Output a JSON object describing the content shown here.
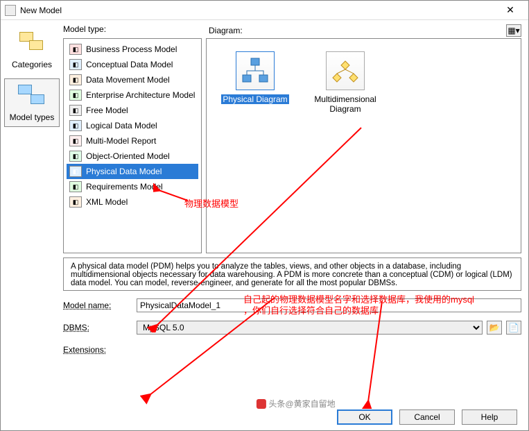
{
  "window": {
    "title": "New Model",
    "close_glyph": "✕"
  },
  "left": {
    "categories_label": "Categories",
    "modeltypes_label": "Model types"
  },
  "headers": {
    "model_type": "Model type:",
    "diagram": "Diagram:"
  },
  "model_types": [
    {
      "label": "Business Process Model"
    },
    {
      "label": "Conceptual Data Model"
    },
    {
      "label": "Data Movement Model"
    },
    {
      "label": "Enterprise Architecture Model"
    },
    {
      "label": "Free Model"
    },
    {
      "label": "Logical Data Model"
    },
    {
      "label": "Multi-Model Report"
    },
    {
      "label": "Object-Oriented Model"
    },
    {
      "label": "Physical Data Model"
    },
    {
      "label": "Requirements Model"
    },
    {
      "label": "XML Model"
    }
  ],
  "diagrams": [
    {
      "label": "Physical Diagram"
    },
    {
      "label": "Multidimensional Diagram"
    }
  ],
  "description": "A physical data model (PDM) helps you to analyze the tables, views, and other objects in a database, including multidimensional objects necessary for data warehousing. A PDM is more concrete than a conceptual (CDM) or logical (LDM) data model. You can model, reverse-engineer, and generate for all the most popular DBMSs.",
  "form": {
    "model_name_label": "Model name:",
    "model_name_value": "PhysicalDataModel_1",
    "dbms_label": "DBMS:",
    "dbms_value": "MySQL 5.0",
    "extensions_label": "Extensions:"
  },
  "buttons": {
    "ok": "OK",
    "cancel": "Cancel",
    "help": "Help"
  },
  "annotations": {
    "a1": "物理数据模型",
    "a2_line1": "自己起的物理数据模型名字和选择数据库，我使用的mysql",
    "a2_line2": "，你们自行选择符合自己的数据库"
  },
  "watermark": "头条@黄家自留地"
}
